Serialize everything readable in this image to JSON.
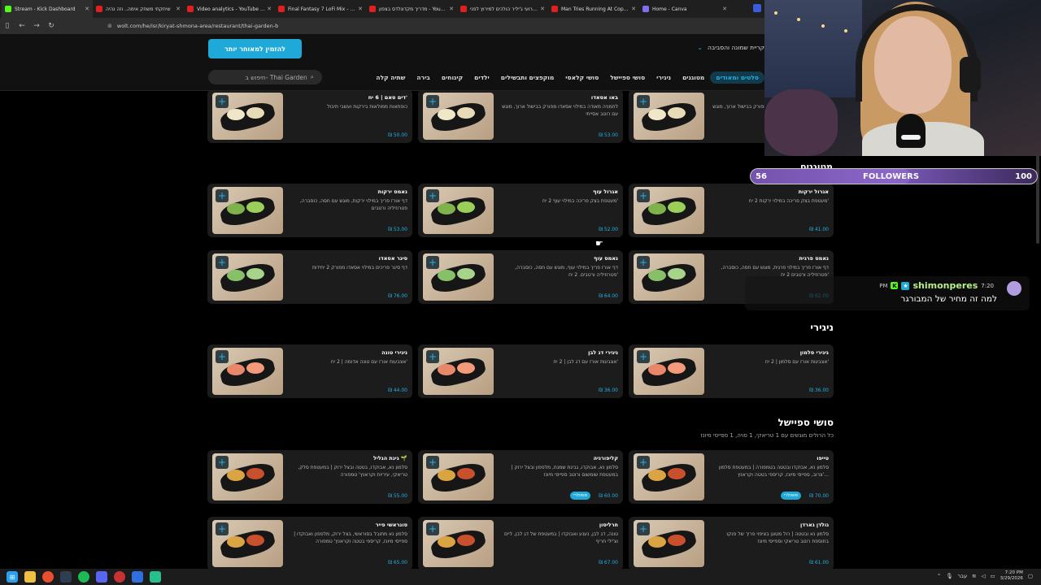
{
  "browser": {
    "tabs": [
      {
        "label": "Stream - Kick Dashboard",
        "color": "#53fc18",
        "active": true
      },
      {
        "label": "שיחקתי משחק אימה.. וזה נהיה",
        "color": "#e02020",
        "active": false
      },
      {
        "label": "Video analytics - YouTube Studio",
        "color": "#e02020",
        "active": false
      },
      {
        "label": "Final Fantasy 7 LoFi Mix - [1Hour]",
        "color": "#e02020",
        "active": false
      },
      {
        "label": "מדריך מקדונלדס בצפון - YouTube",
        "color": "#e02020",
        "active": false
      },
      {
        "label": "אני ורועי ג'יליר הולכים למירוץ לפני",
        "color": "#e02020",
        "active": false
      },
      {
        "label": "Man Tries Running At Cop With",
        "color": "#e02020",
        "active": false
      },
      {
        "label": "Home - Canva",
        "color": "#7d6ff0",
        "active": false
      }
    ],
    "url": "wolt.com/he/isr/kiryat-shmona-area/restaurant/thai-garden-b"
  },
  "site": {
    "cta_label": "להזמין למאוחר יותר",
    "area_label": "קריית שמונה והסביבה",
    "search_placeholder": "חיפוש ב- Thai Garden",
    "categories": [
      {
        "label": "סלטים ומאודים",
        "active": true
      },
      {
        "label": "מטוגנים",
        "active": false
      },
      {
        "label": "ניגירי",
        "active": false
      },
      {
        "label": "סושי ספיישל",
        "active": false
      },
      {
        "label": "סושי קלאסי",
        "active": false
      },
      {
        "label": "מוקפצים ותבשילים",
        "active": false
      },
      {
        "label": "ילדים",
        "active": false
      },
      {
        "label": "קינוחים",
        "active": false
      },
      {
        "label": "בירה",
        "active": false
      },
      {
        "label": "שתיה קלה",
        "active": false
      }
    ]
  },
  "menu": {
    "row_steamed": [
      {
        "title": "באו אסאדו",
        "desc": "לחמניה מאודה במילוי אסאדו מפורק בבישול ארוך, מוגש עם רוטב אסייתי",
        "price": "₪ 53.00"
      },
      {
        "title": "באו אסאדו",
        "desc": "לחמניה מאודה במילוי אסאדו מפורק בבישול ארוך, מוגש עם רוטב אסייתי",
        "price": "₪ 53.00"
      },
      {
        "title": "דים סאם | 6 יח'",
        "desc": "כופתאות ממולאות בירקות ועשבי תיבול",
        "price": "₪ 50.00"
      }
    ],
    "fried_title": "מטוגנים",
    "row_fried_1": [
      {
        "title": "אגרול ירקות",
        "desc": "מעטפת בצק פריכה במילוי ירקות 2 יח'",
        "price": "₪ 41.00"
      },
      {
        "title": "אגרול עוף",
        "desc": "מעטפת בצק פריכה במילוי עוף 2 יח'",
        "price": "₪ 52.00"
      },
      {
        "title": "נאמס ירקות",
        "desc": "דף אורז פריך במילוי ירקות, מוגש עם חסה, כוסברה, פטרוזיליה ורטבים",
        "price": "₪ 53.00"
      }
    ],
    "row_fried_2": [
      {
        "title": "נאמס פרגית",
        "desc": "דף אורז פריך במילוי פרגית, מוגש עם חסה, כוסברה, פטרוזיליה ורטבים 2 יח'",
        "price": "₪ 62.00"
      },
      {
        "title": "נאמס עוף",
        "desc": "דף אורז פריך במילוי עוף, מוגש עם חסה, כוסברה, פטרוזיליה ורטבים. 2 יח'",
        "price": "₪ 64.00"
      },
      {
        "title": "סיגר אסאדו",
        "desc": "דף סיגר פריכים במילוי אסאדו מפורק 2 יחידות",
        "price": "₪ 76.00"
      }
    ],
    "nigiri_title": "ניגירי",
    "row_nigiri": [
      {
        "title": "ניגירי סלמון",
        "desc": "אצבעות אורז עם סלמון | 2 יח'",
        "price": "₪ 36.00"
      },
      {
        "title": "ניגירי דג לבן",
        "desc": "אצבעות אורז עם דג לבן | 2 יח'",
        "price": "₪ 36.00"
      },
      {
        "title": "ניגירי טונה",
        "desc": "אצבעות אורז עם טונה אדומה | 2 יח'",
        "price": "₪ 44.00"
      }
    ],
    "special_title": "סושי ספיישל",
    "special_desc": "כל הרולים מוגשים עם 1 טריאקי, 1 סויה, 1 ספייסי מיונז",
    "row_special_1": [
      {
        "title": "טייפו",
        "desc": "סלמון נא, אבוקדו ובטטה בטמפורה | במעטפת סלמון צרוב, ספייסי מיונז, קריספי בטטה וקראנץ'...",
        "price": "₪ 70.00",
        "badge": "פופולרי"
      },
      {
        "title": "קליפורניה",
        "desc": "סלמון נא, אבוקדו, גבינת שמנת, מלפפון ובצל ירוק | במעטפת שומשום ורוטב ספייסי מיונז",
        "price": "₪ 60.00",
        "badge": "פופולרי"
      },
      {
        "title": "גינת הגליל 🌱",
        "desc": "סלמון נא, אבוקדו, בטטה ובצל ירוק | במעטפת סלק, טריאקי, עיריות וקראנץ' טמפורה",
        "price": "₪ 55.00"
      }
    ],
    "row_special_2": [
      {
        "title": "גולדן גארדן",
        "desc": "סלמון נא ובטטה | רול מטוגן בציפוי פריך של פנקו בתוספת רוטב טריאקי וספייסי מיונז",
        "price": "₪ 61.00"
      },
      {
        "title": "חרליסון",
        "desc": "טונה, דג לבן, נענע ואבוקדו | במעטפת של דג לבן, ליים וצ'ילי חריף",
        "price": "₪ 67.00"
      },
      {
        "title": "סונראשי פייר",
        "desc": "סלמון נא מתובל בסוראשי, בצל ירוק, מלפפון ואבוקדו | ספייסי מיונז, קריספי בטטה וקראנץ' טמפורה",
        "price": "₪ 65.00"
      }
    ]
  },
  "stream_overlay": {
    "followers_current": "56",
    "followers_label": "FOLLOWERS",
    "followers_goal": "100",
    "followers_progress": 0.56,
    "chat": {
      "pm": "PM",
      "username": "shimonperes",
      "time": "7:20",
      "message": "למה זה מחיר של המבורגר"
    }
  },
  "taskbar": {
    "lang": "עבר",
    "time": "7:20 PM",
    "date": "3/29/2026"
  }
}
